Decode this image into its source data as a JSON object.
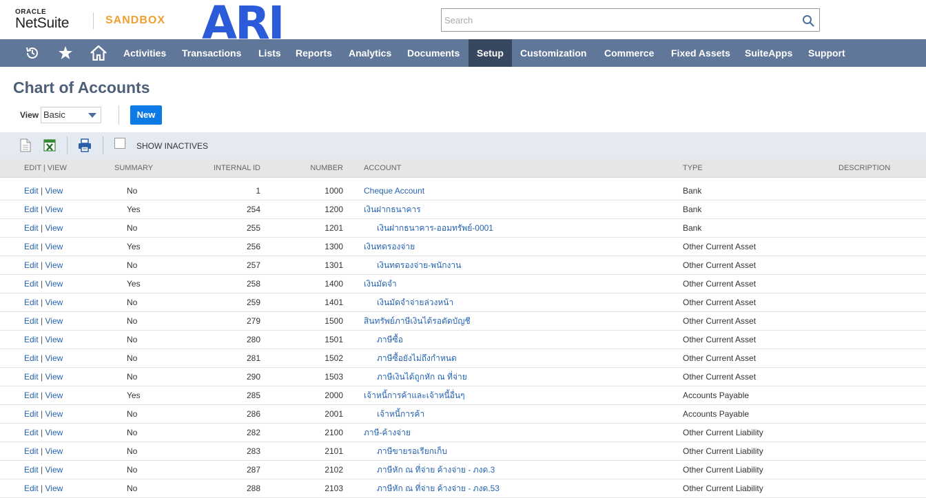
{
  "header": {
    "oracle_text": "ORACLE",
    "netsuite_text": "NetSuite",
    "sandbox_text": "SANDBOX",
    "company_logo_text": "ARI",
    "search_placeholder": "Search"
  },
  "nav": {
    "icons": [
      "recent-icon",
      "star-icon",
      "home-icon"
    ],
    "items": [
      "Activities",
      "Transactions",
      "Lists",
      "Reports",
      "Analytics",
      "Documents",
      "Setup",
      "Customization",
      "Commerce",
      "Fixed Assets",
      "SuiteApps",
      "Support"
    ],
    "active": "Setup"
  },
  "page": {
    "title": "Chart of Accounts",
    "view_label": "View",
    "view_value": "Basic",
    "new_button": "New",
    "show_inactives": "SHOW INACTIVES"
  },
  "table": {
    "columns": {
      "edit_view": "EDIT | VIEW",
      "summary": "SUMMARY",
      "internal_id": "INTERNAL ID",
      "number": "NUMBER",
      "account": "ACCOUNT",
      "type": "TYPE",
      "description": "DESCRIPTION"
    },
    "edit_label": "Edit",
    "view_label": "View",
    "rows": [
      {
        "summary": "No",
        "internal_id": "1",
        "number": "1000",
        "account": "Cheque Account",
        "child": false,
        "type": "Bank"
      },
      {
        "summary": "Yes",
        "internal_id": "254",
        "number": "1200",
        "account": "เงินฝากธนาคาร",
        "child": false,
        "type": "Bank"
      },
      {
        "summary": "No",
        "internal_id": "255",
        "number": "1201",
        "account": "เงินฝากธนาคาร-ออมทรัพย์-0001",
        "child": true,
        "type": "Bank"
      },
      {
        "summary": "Yes",
        "internal_id": "256",
        "number": "1300",
        "account": "เงินทดรองจ่าย",
        "child": false,
        "type": "Other Current Asset"
      },
      {
        "summary": "No",
        "internal_id": "257",
        "number": "1301",
        "account": "เงินทดรองจ่าย-พนักงาน",
        "child": true,
        "type": "Other Current Asset"
      },
      {
        "summary": "Yes",
        "internal_id": "258",
        "number": "1400",
        "account": "เงินมัดจำ",
        "child": false,
        "type": "Other Current Asset"
      },
      {
        "summary": "No",
        "internal_id": "259",
        "number": "1401",
        "account": "เงินมัดจำจ่ายล่วงหน้า",
        "child": true,
        "type": "Other Current Asset"
      },
      {
        "summary": "No",
        "internal_id": "279",
        "number": "1500",
        "account": "สินทรัพย์ภาษีเงินได้รอตัดบัญชี",
        "child": false,
        "type": "Other Current Asset"
      },
      {
        "summary": "No",
        "internal_id": "280",
        "number": "1501",
        "account": "ภาษีซื้อ",
        "child": true,
        "type": "Other Current Asset"
      },
      {
        "summary": "No",
        "internal_id": "281",
        "number": "1502",
        "account": "ภาษีซื้อยังไม่ถึงกำหนด",
        "child": true,
        "type": "Other Current Asset"
      },
      {
        "summary": "No",
        "internal_id": "290",
        "number": "1503",
        "account": "ภาษีเงินได้ถูกหัก ณ ที่จ่าย",
        "child": true,
        "type": "Other Current Asset"
      },
      {
        "summary": "Yes",
        "internal_id": "285",
        "number": "2000",
        "account": "เจ้าหนี้การค้าและเจ้าหนี้อื่นๆ",
        "child": false,
        "type": "Accounts Payable"
      },
      {
        "summary": "No",
        "internal_id": "286",
        "number": "2001",
        "account": "เจ้าหนี้การค้า",
        "child": true,
        "type": "Accounts Payable"
      },
      {
        "summary": "No",
        "internal_id": "282",
        "number": "2100",
        "account": "ภาษี-ค้างจ่าย",
        "child": false,
        "type": "Other Current Liability"
      },
      {
        "summary": "No",
        "internal_id": "283",
        "number": "2101",
        "account": "ภาษีขายรอเรียกเก็บ",
        "child": true,
        "type": "Other Current Liability"
      },
      {
        "summary": "No",
        "internal_id": "287",
        "number": "2102",
        "account": "ภาษีหัก ณ ที่จ่าย ค้างจ่าย - ภงด.3",
        "child": true,
        "type": "Other Current Liability"
      },
      {
        "summary": "No",
        "internal_id": "288",
        "number": "2103",
        "account": "ภาษีหัก ณ ที่จ่าย ค้างจ่าย - ภงด.53",
        "child": true,
        "type": "Other Current Liability"
      }
    ]
  }
}
